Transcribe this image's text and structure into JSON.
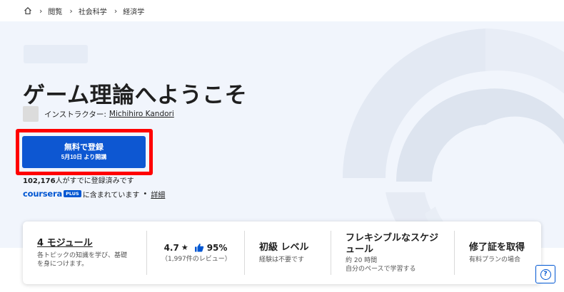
{
  "breadcrumb": {
    "items": [
      "閲覧",
      "社会科学",
      "経済学"
    ]
  },
  "course": {
    "title": "ゲーム理論へようこそ",
    "instructor_label": "インストラクター:",
    "instructor_name": "Michihiro Kandori"
  },
  "enroll": {
    "main_label": "無料で登録",
    "sub_label": "5月10日 より開講"
  },
  "enrollment": {
    "count": "102,176",
    "suffix": "人がすでに登録済みです"
  },
  "plus": {
    "brand": "coursera",
    "badge": "PLUS",
    "text": "に含まれています",
    "separator": "•",
    "details_link": "詳細"
  },
  "info": {
    "modules_title": "4 モジュール",
    "modules_desc": "各トピックの知識を学び、基礎を身につけます。",
    "rating": "4.7",
    "approval": "95%",
    "reviews": "（1,997件のレビュー）",
    "level_title": "初級 レベル",
    "level_desc": "経験は不要です",
    "schedule_title": "フレキシブルなスケジュール",
    "schedule_hours": "約 20 時間",
    "schedule_desc": "自分のペースで学習する",
    "cert_title": "修了証を取得",
    "cert_desc": "有料プランの場合"
  },
  "help": {
    "icon_text": "?"
  },
  "colors": {
    "accent": "#0056d2",
    "highlight": "#ff0000",
    "hero_bg": "#f1f5fc"
  }
}
